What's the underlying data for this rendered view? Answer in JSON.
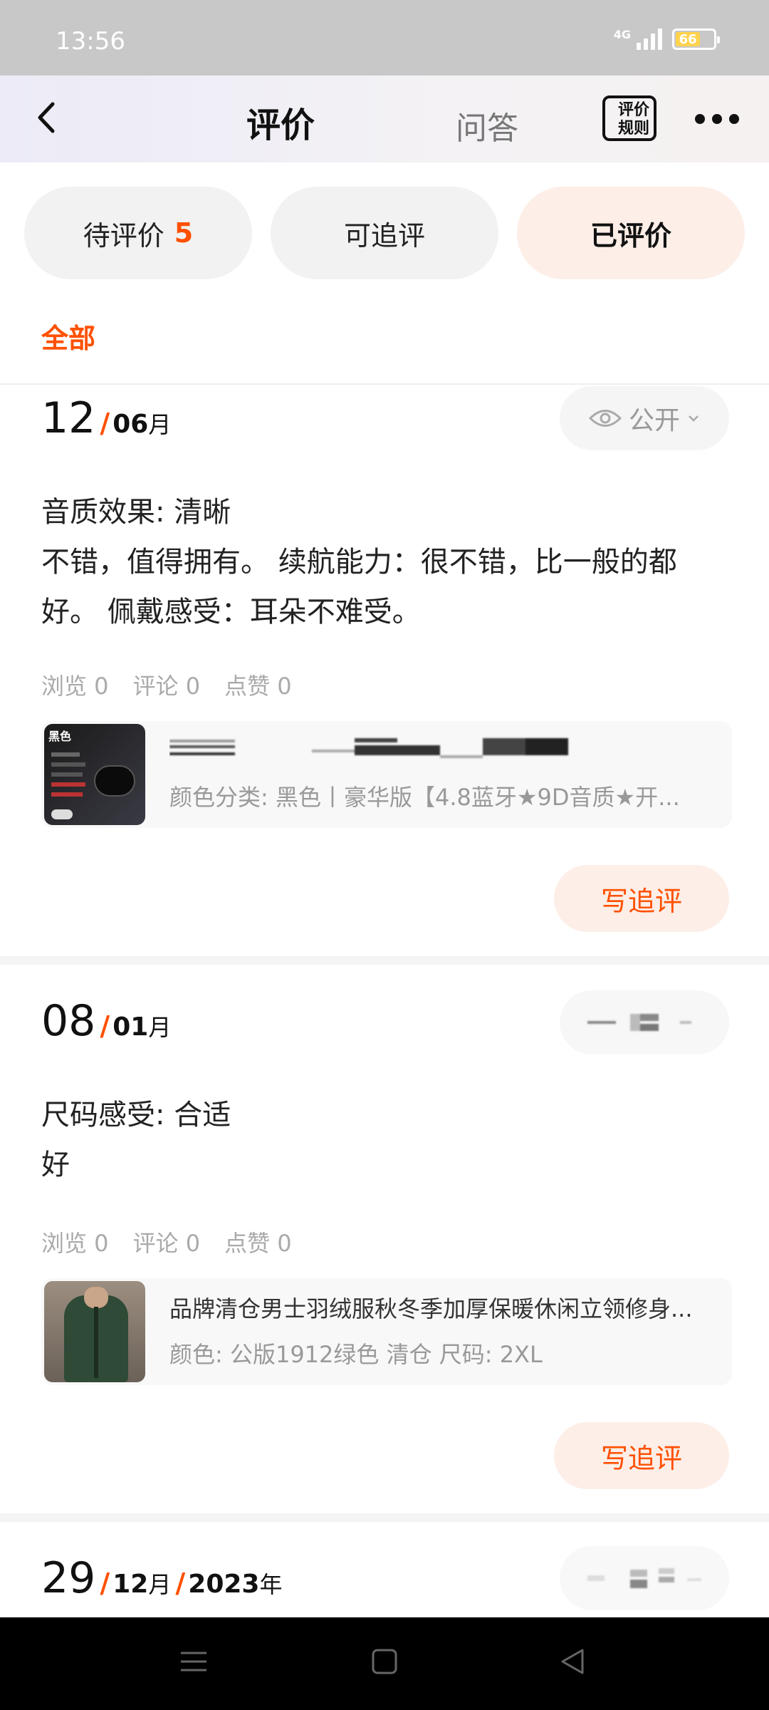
{
  "status": {
    "time": "13:56",
    "network": "4G",
    "battery": "66"
  },
  "nav": {
    "title": "评价",
    "qa_tab": "问答",
    "rules_line1": "评价",
    "rules_line2": "规则"
  },
  "segments": [
    {
      "label": "待评价",
      "count": "5"
    },
    {
      "label": "可追评",
      "count": ""
    },
    {
      "label": "已评价",
      "count": ""
    }
  ],
  "filter": {
    "all": "全部"
  },
  "reviews": [
    {
      "day": "12",
      "month": "06",
      "month_suffix": "月",
      "year": "",
      "privacy": "公开",
      "line1": "音质效果: 清晰",
      "body": "不错，值得拥有。  续航能力：很不错，比一般的都好。 佩戴感受：耳朵不难受。",
      "views": "浏览 0",
      "comments": "评论 0",
      "likes": "点赞 0",
      "product_title": "",
      "product_spec": "颜色分类: 黑色丨豪华版【4.8蓝牙★9D音质★开...",
      "thumb_label": "黑色",
      "follow": "写追评"
    },
    {
      "day": "08",
      "month": "01",
      "month_suffix": "月",
      "year": "",
      "privacy": "",
      "line1": "尺码感受: 合适",
      "body": "好",
      "views": "浏览 0",
      "comments": "评论 0",
      "likes": "点赞 0",
      "product_title": "品牌清仓男士羽绒服秋冬季加厚保暖休闲立领修身...",
      "product_spec": "颜色: 公版1912绿色 清仓 尺码: 2XL",
      "follow": "写追评"
    },
    {
      "day": "29",
      "month": "12",
      "month_suffix": "月",
      "year": "2023",
      "year_suffix": "年"
    }
  ],
  "colors": {
    "accent": "#ff5000",
    "accent_bg": "#fdeee8"
  }
}
